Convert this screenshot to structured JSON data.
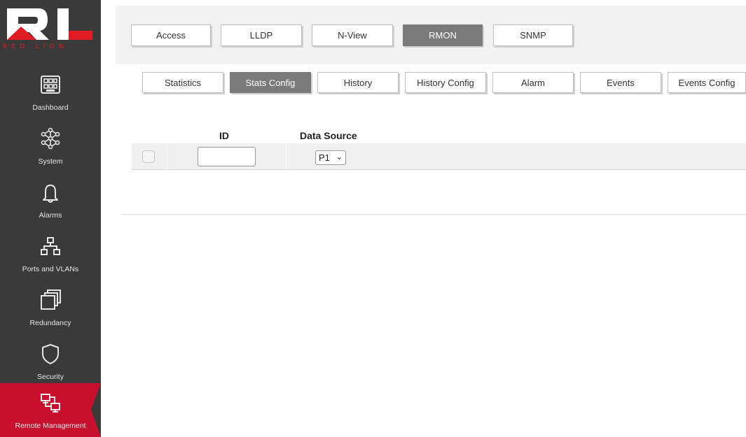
{
  "brand": {
    "logo_text": "RL",
    "name": "RED LION",
    "primary_color": "#e21c23",
    "sidebar_color": "#3a3a3a"
  },
  "sidebar": {
    "items": [
      {
        "label": "Dashboard",
        "icon": "dashboard-icon"
      },
      {
        "label": "System",
        "icon": "system-network-icon"
      },
      {
        "label": "Alarms",
        "icon": "bell-icon"
      },
      {
        "label": "Ports and VLANs",
        "icon": "network-topology-icon"
      },
      {
        "label": "Redundancy",
        "icon": "stacked-windows-icon"
      },
      {
        "label": "Security",
        "icon": "shield-icon"
      },
      {
        "label": "Remote Management",
        "icon": "remote-computers-icon",
        "active": true
      }
    ]
  },
  "top_tabs": [
    {
      "label": "Access"
    },
    {
      "label": "LLDP"
    },
    {
      "label": "N-View"
    },
    {
      "label": "RMON",
      "active": true
    },
    {
      "label": "SNMP"
    }
  ],
  "sub_tabs": [
    {
      "label": "Statistics"
    },
    {
      "label": "Stats Config",
      "active": true
    },
    {
      "label": "History"
    },
    {
      "label": "History Config"
    },
    {
      "label": "Alarm"
    },
    {
      "label": "Events"
    },
    {
      "label": "Events Config"
    }
  ],
  "table": {
    "headers": {
      "id": "ID",
      "data_source": "Data Source"
    },
    "rows": [
      {
        "checked": false,
        "id_value": "",
        "data_source": "P1"
      }
    ]
  }
}
